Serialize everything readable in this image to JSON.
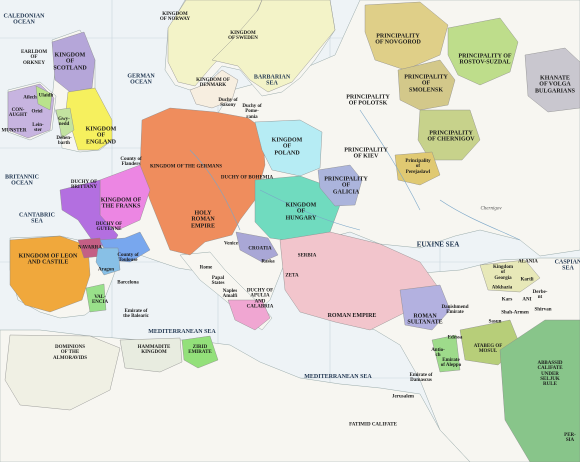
{
  "labels": {
    "caledonian_ocean": "CALEDONIAN\nOCEAN",
    "earldom_orkney": "EARLDOM\nOF\nORKNEY",
    "kingdom_scotland": "KINGDOM\nOF\nSCOTLAND",
    "kingdom_norway": "KINGDOM\nOF NORWAY",
    "kingdom_sweden": "KINGDOM\nOF SWEDEN",
    "principality_novgorod": "PRINCIPALITY\nOF NOVGOROD",
    "principality_rostov_suzdal": "PRINCIPALITY OF\nROSTOV-SUZDAL",
    "khanate_volga_bulgarians": "KHANATE\nOF VOLGA\nBULGARIANS",
    "german_ocean": "GERMAN\nOCEAN",
    "kingdom_denmark": "KINGDOM OF\nDENMARK",
    "barbarian_sea": "BARBARIAN\nSEA",
    "principality_polotsk": "PRINCIPALITY\nOF POLOTSK",
    "principality_smolensk": "PRINCIPALITY\nOF\nSMOLENSK",
    "ailech": "Ailech",
    "oriel": "Oriel",
    "ulaidh": "Ulaidh",
    "connaught": "CON-\nAUGHT",
    "munster": "MUNSTER",
    "leinster": "Lein-\nster",
    "gwynedd": "Gwy-\nnedd",
    "deheubarth": "Dehen-\nbarth",
    "kingdom_england": "KINGDOM\nOF\nENGLAND",
    "duchy_saxony": "Duchy of\nSaxony",
    "duchy_pomerania": "Duchy of\nPome-\nrania",
    "kingdom_poland": "KINGDOM\nOF\nPOLAND",
    "principality_kiev": "PRINCIPALITY\nOF KIEV",
    "principality_chernigov": "PRINCIPALITY\nOF CHERNIGOV",
    "principality_pereyaslavl": "Principality\nof\nPerejaslawl",
    "britannic_ocean": "BRITANNIC\nOCEAN",
    "county_flanders": "County of\nFlanders",
    "kingdom_germans": "KINGDOM OF THE GERMANS",
    "duchy_bohemia": "DUCHY OF BOHEMIA",
    "principality_galicia": "PRINCIPALITY\nOF\nGALICIA",
    "duchy_brittany": "DUCHY OF\nBRITTANY",
    "kingdom_franks": "KINGDOM OF\nTHE FRANKS",
    "holy_roman_empire": "HOLY\nROMAN\nEMPIRE",
    "kingdom_hungary": "KINGDOM\nOF\nHUNGARY",
    "chernigov_town": "Chernigov",
    "cantabric_sea": "CANTABRIC\nSEA",
    "duchy_guyenne": "DUCHY OF\nGUYENNE",
    "county_toulouse": "County of\nToulouse",
    "venice": "Venice",
    "croatia": "CROATIA",
    "serbia": "SERBIA",
    "alania": "ALANIA",
    "caspian_sea": "CASPIAN\nSEA",
    "kingdom_leon_castile": "KINGDOM OF LEON\nAND CASTILE",
    "navarra": "NAVARRA",
    "aragon": "Aragon",
    "barcelona": "Barcelona",
    "rome": "Rome",
    "papal_states": "Papal\nStates",
    "raska": "Raska",
    "zeta": "ZETA",
    "euxine_sea": "EUXINE SEA",
    "kingdom_georgia": "Kingdom\nof\nGeorgia",
    "abkhazia": "Abkhazia",
    "kartli": "Kartli",
    "derbent": "Derbe-\nnt",
    "valencia": "VAL-\nENCIA",
    "emirate_balearic": "Emirate of\nthe Balearic",
    "naples": "Naples\nAmalfi",
    "duchy_apulia_calabria": "DUCHY OF\nAPULIA\nAND\nCALABRIA",
    "danishmend_emirate": "Danishmend\nEmirate",
    "kars": "Kars",
    "ani": "ANI",
    "shirvan": "Shirvan",
    "roman_empire": "ROMAN EMPIRE",
    "roman_sultanate": "ROMAN\nSULTANATE",
    "sasun": "Sasun",
    "shah_armen": "Shah-Armen",
    "mediterranean_sea_w": "MEDITERRANEAN SEA",
    "dominions_almoravids": "DOMINIONS\nOF THE\nALMORAVIDS",
    "hammadite_kingdom": "HAMMADITE\nKINGDOM",
    "zirid_emirate": "ZIRID\nEMIRATE",
    "ataleg_mosul": "ATABEG OF\nMOSUL",
    "edessa": "Edessa",
    "emirate_aleppo": "Emirate\nof Aleppo",
    "antioch": "Antio-\nch",
    "emirate_damascus": "Emirate of\nDamascus",
    "jerusalem": "Jerusalem",
    "mediterranean_sea_e": "MEDITERRANEAN SEA",
    "abbasid_caliphate": "ABBASSID CALIFATE\nUNDER SELJUK RULE",
    "fatimid_caliphate": "FATIMID CALIFATE",
    "persia": "PER-\nSIA"
  }
}
